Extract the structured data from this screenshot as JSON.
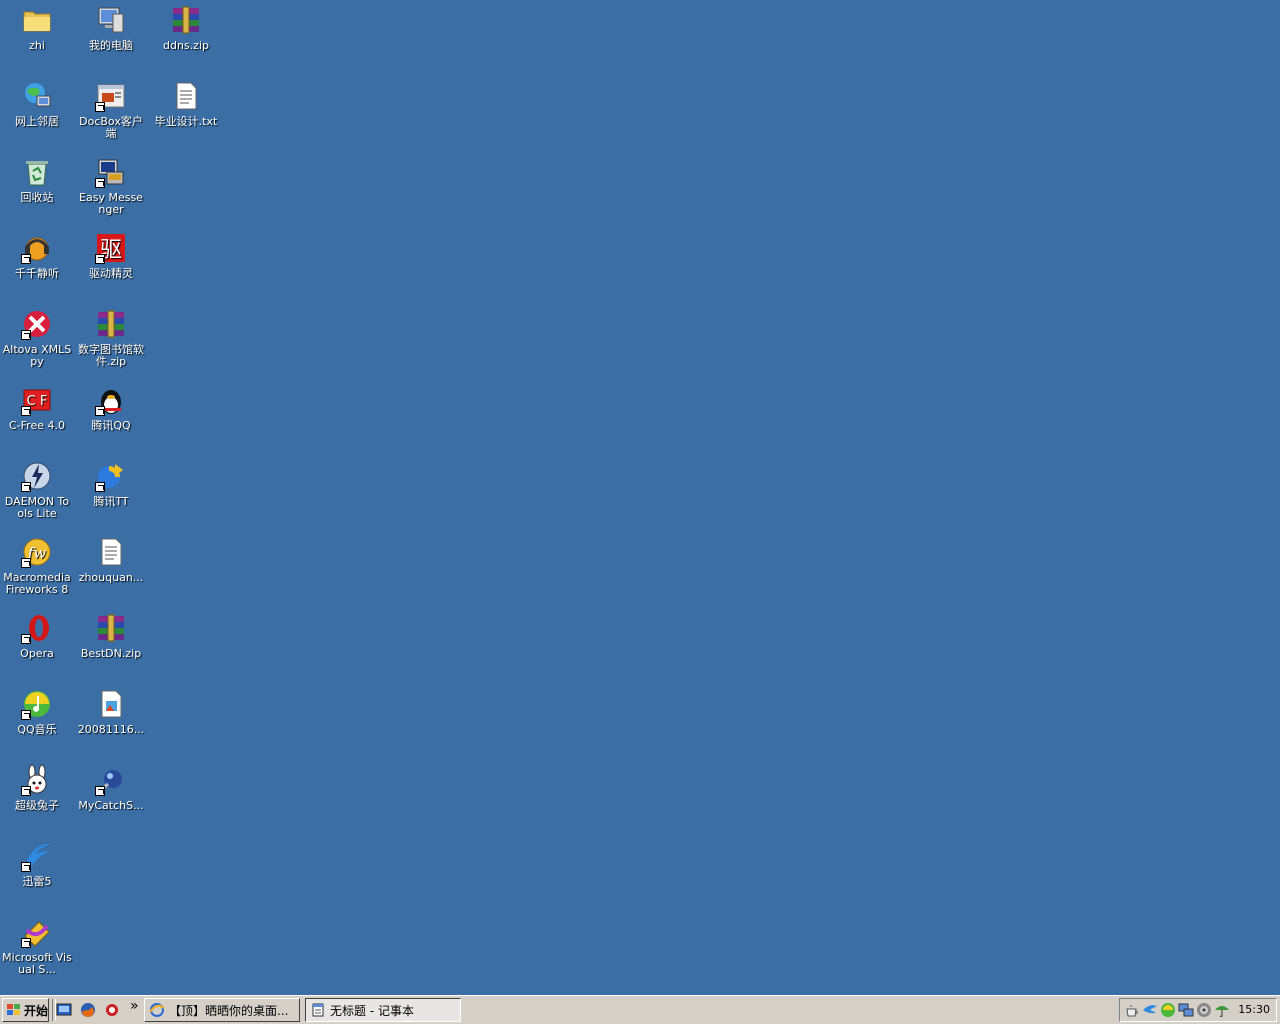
{
  "desktop": {
    "background": "#3a6ea5",
    "icons": [
      {
        "label": "zhi",
        "icon": "folder-icon"
      },
      {
        "label": "我的电脑",
        "icon": "my-computer-icon"
      },
      {
        "label": "ddns.zip",
        "icon": "winrar-archive-icon"
      },
      {
        "label": "网上邻居",
        "icon": "network-places-icon"
      },
      {
        "label": "DocBox客户端",
        "icon": "docbox-icon"
      },
      {
        "label": "毕业设计.txt",
        "icon": "text-file-icon"
      },
      {
        "label": "回收站",
        "icon": "recycle-bin-icon"
      },
      {
        "label": "Easy Messenger",
        "icon": "easy-messenger-icon"
      },
      {
        "label": "千千静听",
        "icon": "ttplayer-icon"
      },
      {
        "label": "驱动精灵",
        "icon": "driver-genius-icon"
      },
      {
        "label": "Altova XMLSpy",
        "icon": "xmlspy-icon"
      },
      {
        "label": "数字图书馆软件.zip",
        "icon": "winrar-archive-icon"
      },
      {
        "label": "C-Free 4.0",
        "icon": "cfree-icon"
      },
      {
        "label": "腾讯QQ",
        "icon": "qq-penguin-icon"
      },
      {
        "label": "DAEMON Tools Lite",
        "icon": "daemon-tools-icon"
      },
      {
        "label": "腾讯TT",
        "icon": "tencent-tt-icon"
      },
      {
        "label": "Macromedia Fireworks 8",
        "icon": "fireworks-icon"
      },
      {
        "label": "zhouquan...",
        "icon": "text-file-icon"
      },
      {
        "label": "Opera",
        "icon": "opera-icon"
      },
      {
        "label": "BestDN.zip",
        "icon": "winrar-archive-icon"
      },
      {
        "label": "QQ音乐",
        "icon": "qq-music-icon"
      },
      {
        "label": "20081116...",
        "icon": "image-file-icon"
      },
      {
        "label": "超级兔子",
        "icon": "super-rabbit-icon"
      },
      {
        "label": "MyCatchS...",
        "icon": "mycatch-icon"
      },
      {
        "label": "迅雷5",
        "icon": "thunder-icon"
      },
      {
        "label": "Microsoft Visual S...",
        "icon": "visual-studio-icon"
      }
    ]
  },
  "taskbar": {
    "start_label": "开始",
    "more_label": "»",
    "quick_launch": [
      "show-desktop-icon",
      "firefox-icon",
      "app-quick-icon"
    ],
    "tasks": [
      {
        "label": "【顶】晒晒你的桌面...",
        "icon": "ie-icon",
        "active": false
      },
      {
        "label": "无标题 - 记事本",
        "icon": "notepad-icon",
        "active": true
      }
    ],
    "tray_icons": [
      "tray-tea-icon",
      "tray-arrow-icon",
      "tray-green-icon",
      "tray-network-icon",
      "tray-volume-icon",
      "tray-umbrella-icon"
    ],
    "clock": "15:30"
  }
}
